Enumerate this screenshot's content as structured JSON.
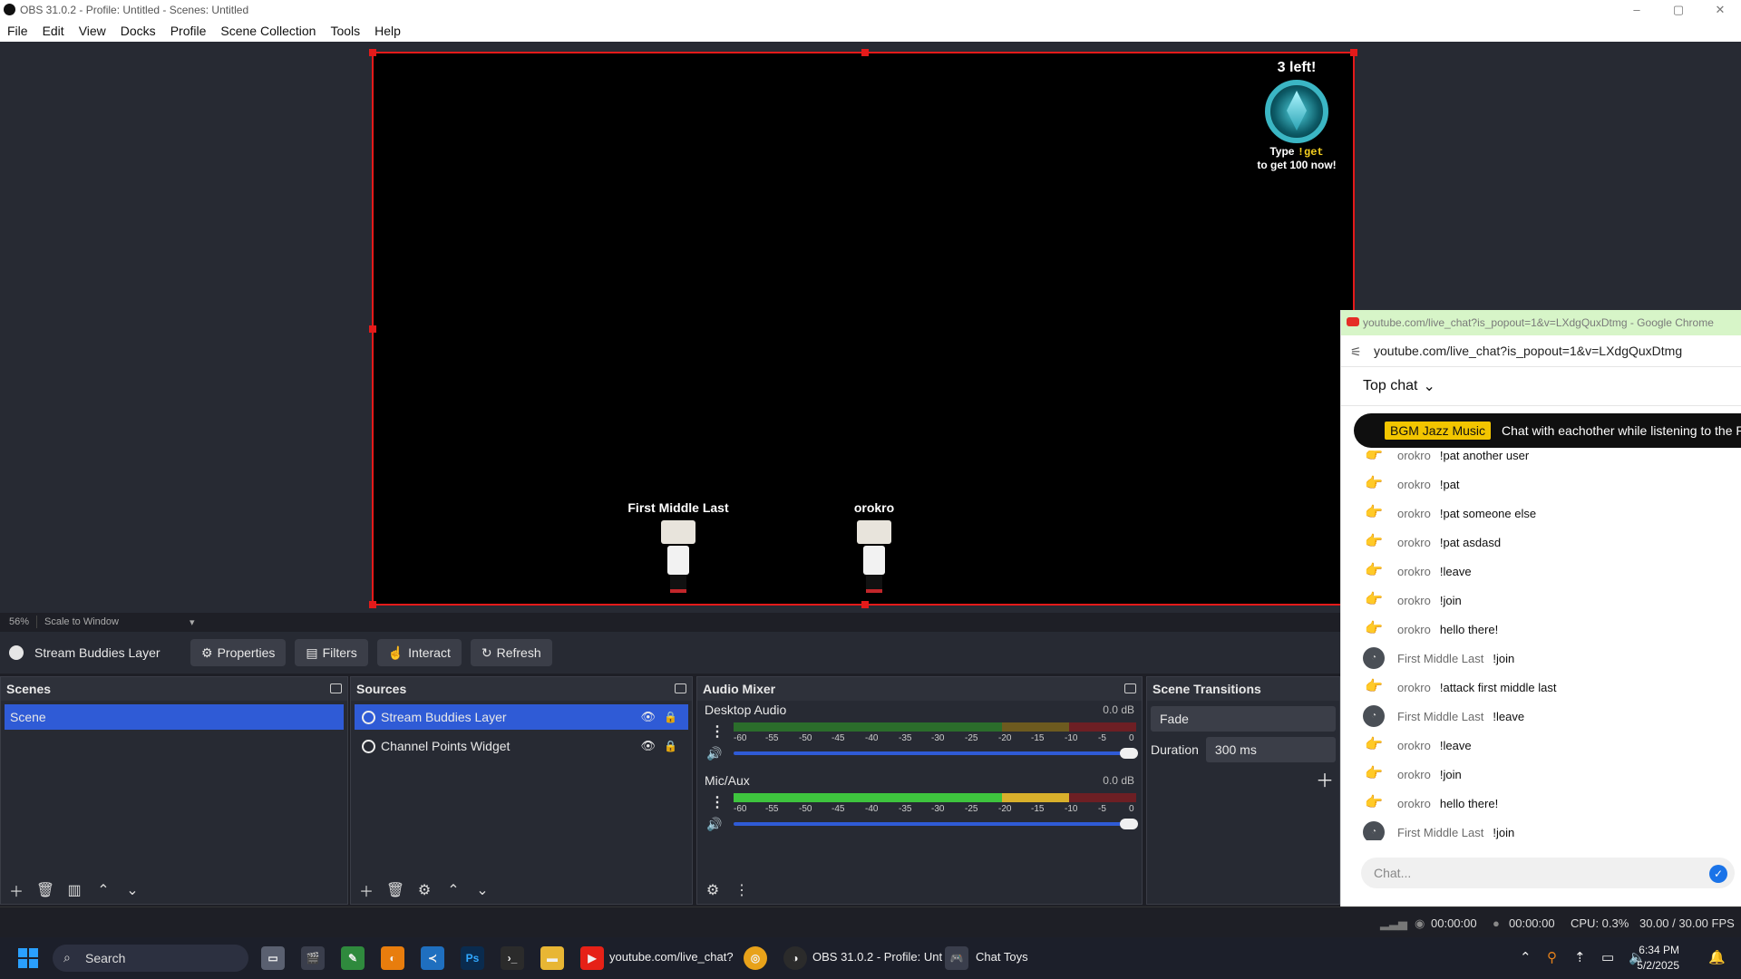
{
  "window": {
    "title": "OBS 31.0.2 - Profile: Untitled - Scenes: Untitled",
    "controls": [
      "–",
      "▢",
      "✕"
    ]
  },
  "menu": [
    "File",
    "Edit",
    "View",
    "Docks",
    "Profile",
    "Scene Collection",
    "Tools",
    "Help"
  ],
  "preview": {
    "widget": {
      "count_text": "3 left!",
      "line1_prefix": "Type",
      "command": "!get",
      "line2": "to get 100 now!"
    },
    "buddies": [
      "First Middle Last",
      "orokro"
    ]
  },
  "status_line": {
    "zoom": "56%",
    "mode": "Scale to Window"
  },
  "source_toolbar": {
    "selected_source": "Stream Buddies Layer",
    "properties": "Properties",
    "filters": "Filters",
    "interact": "Interact",
    "refresh": "Refresh"
  },
  "scenes": {
    "title": "Scenes",
    "items": [
      "Scene"
    ]
  },
  "sources": {
    "title": "Sources",
    "items": [
      {
        "name": "Stream Buddies Layer",
        "selected": true
      },
      {
        "name": "Channel Points Widget",
        "selected": false
      }
    ]
  },
  "mixer": {
    "title": "Audio Mixer",
    "ticks": [
      "-60",
      "-55",
      "-50",
      "-45",
      "-40",
      "-35",
      "-30",
      "-25",
      "-20",
      "-15",
      "-10",
      "-5",
      "0"
    ],
    "channels": [
      {
        "name": "Desktop Audio",
        "db": "0.0 dB"
      },
      {
        "name": "Mic/Aux",
        "db": "0.0 dB"
      }
    ]
  },
  "transitions": {
    "title": "Scene Transitions",
    "selected": "Fade",
    "duration_label": "Duration",
    "duration_value": "300 ms"
  },
  "obs_status": {
    "stream_time": "00:00:00",
    "rec_time": "00:00:00",
    "cpu": "CPU: 0.3%",
    "fps": "30.00 / 30.00 FPS"
  },
  "chrome": {
    "title": "youtube.com/live_chat?is_popout=1&v=LXdgQuxDtmg - Google Chrome",
    "url": "youtube.com/live_chat?is_popout=1&v=LXdgQuxDtmg",
    "chat_mode": "Top chat",
    "pinned": {
      "badge": "BGM Jazz Music",
      "text": "Chat with eachother while listening to the REA"
    },
    "messages": [
      {
        "author": "orokro",
        "text": "!pat another user",
        "avatar": "hand"
      },
      {
        "author": "orokro",
        "text": "!pat",
        "avatar": "hand"
      },
      {
        "author": "orokro",
        "text": "!pat someone else",
        "avatar": "hand"
      },
      {
        "author": "orokro",
        "text": "!pat asdasd",
        "avatar": "hand"
      },
      {
        "author": "orokro",
        "text": "!leave",
        "avatar": "hand"
      },
      {
        "author": "orokro",
        "text": "!join",
        "avatar": "hand"
      },
      {
        "author": "orokro",
        "text": "hello there!",
        "avatar": "hand"
      },
      {
        "author": "First Middle Last",
        "text": "!join",
        "avatar": "photo"
      },
      {
        "author": "orokro",
        "text": "!attack first middle last",
        "avatar": "hand"
      },
      {
        "author": "First Middle Last",
        "text": "!leave",
        "avatar": "photo"
      },
      {
        "author": "orokro",
        "text": "!leave",
        "avatar": "hand"
      },
      {
        "author": "orokro",
        "text": "!join",
        "avatar": "hand"
      },
      {
        "author": "orokro",
        "text": "hello there!",
        "avatar": "hand"
      },
      {
        "author": "First Middle Last",
        "text": "!join",
        "avatar": "photo"
      }
    ],
    "input_placeholder": "Chat..."
  },
  "taskbar": {
    "search": "Search",
    "apps": [
      {
        "name": "task-view",
        "label": ""
      },
      {
        "name": "clapper",
        "label": ""
      },
      {
        "name": "notepad",
        "label": ""
      },
      {
        "name": "blender",
        "label": ""
      },
      {
        "name": "vscode",
        "label": ""
      },
      {
        "name": "photoshop",
        "label": "Ps"
      },
      {
        "name": "terminal",
        "label": ""
      },
      {
        "name": "explorer",
        "label": ""
      }
    ],
    "youtube_label": "youtube.com/live_chat?",
    "obs_label": "OBS 31.0.2 - Profile: Unt",
    "chattoys_label": "Chat Toys",
    "time": "6:34 PM",
    "date": "5/2/2025"
  }
}
